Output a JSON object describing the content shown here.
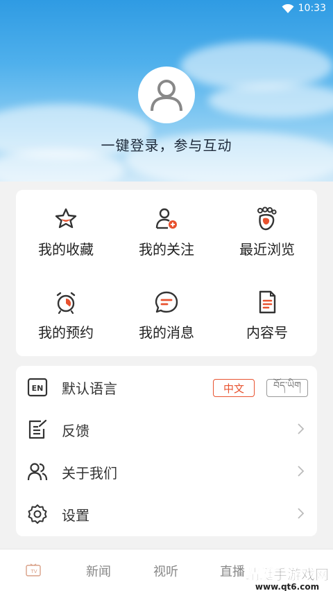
{
  "status": {
    "time": "10:33"
  },
  "profile": {
    "login_prompt": "一键登录，参与互动"
  },
  "grid": [
    {
      "label": "我的收藏",
      "icon": "star-icon"
    },
    {
      "label": "我的关注",
      "icon": "user-add-icon"
    },
    {
      "label": "最近浏览",
      "icon": "footprint-icon"
    },
    {
      "label": "我的预约",
      "icon": "alarm-clock-icon"
    },
    {
      "label": "我的消息",
      "icon": "message-icon"
    },
    {
      "label": "内容号",
      "icon": "document-icon"
    }
  ],
  "settings": {
    "language": {
      "label": "默认语言",
      "option_zh": "中文",
      "option_bo": "བོད་ཡིག"
    },
    "feedback": {
      "label": "反馈"
    },
    "about": {
      "label": "关于我们"
    },
    "settings": {
      "label": "设置"
    }
  },
  "nav": {
    "tv_label": "TV",
    "news": "新闻",
    "av": "视听",
    "live": "直播"
  },
  "watermark": {
    "line1": "蜻蜓手游戏网",
    "line2": "www.qt6.com"
  },
  "colors": {
    "accent": "#e8522f",
    "icon_dark": "#333333"
  }
}
